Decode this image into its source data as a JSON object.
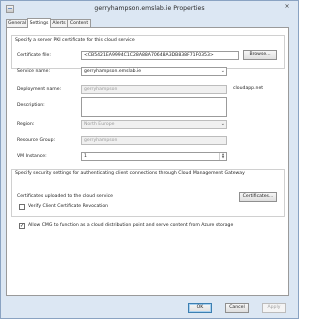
{
  "window": {
    "title": "gerryhampson.emslab.ie Properties",
    "close": "×"
  },
  "tabs": [
    {
      "label": "General",
      "active": false
    },
    {
      "label": "Settings",
      "active": true
    },
    {
      "label": "Alerts",
      "active": false
    },
    {
      "label": "Content",
      "active": false
    }
  ],
  "pki": {
    "heading": "Specify a server PKI certificate for this cloud service",
    "certificate_label": "Certificate file:",
    "certificate_value": "<CB5421EA9994C1C28A88A70648A3DB838F71F0353>",
    "browse_button": "Browse..."
  },
  "service": {
    "name_label": "Service name:",
    "name_value": "gerryhampson.emslab.ie",
    "deployment_label": "Deployment name:",
    "deployment_value": "gerryhampson",
    "deployment_suffix": "cloudapp.net",
    "description_label": "Description:",
    "description_value": "",
    "region_label": "Region:",
    "region_value": "North Europe",
    "resource_group_label": "Resource Group:",
    "resource_group_value": "gerryhampson",
    "vm_instance_label": "VM Instance:",
    "vm_instance_value": "1"
  },
  "security": {
    "heading": "Specify security settings for authenticating client connections through Cloud Management Gateway",
    "certificates_label": "Certificates uploaded to the cloud service",
    "certificates_button": "Certificates...",
    "verify_label": "Verify Client Certificate Revocation",
    "verify_checked": false
  },
  "allow_cmg": {
    "label": "Allow CMG to function as a cloud distribution point and serve content from Azure storage",
    "checked": true,
    "check_glyph": "✓"
  },
  "footer": {
    "ok": "OK",
    "cancel": "Cancel",
    "apply": "Apply"
  }
}
